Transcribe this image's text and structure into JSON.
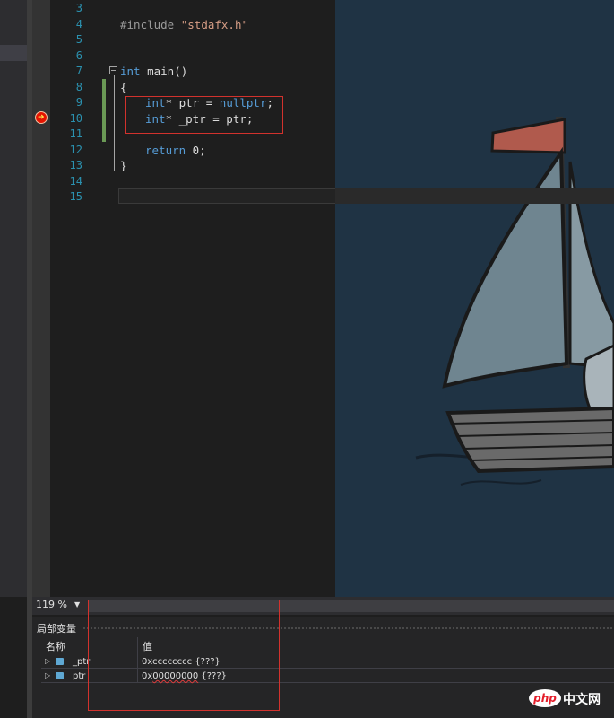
{
  "editor": {
    "line_numbers": [
      "3",
      "4",
      "5",
      "6",
      "7",
      "8",
      "9",
      "10",
      "11",
      "12",
      "13",
      "14",
      "15"
    ],
    "code": {
      "include_kw": "#include",
      "include_str": "\"stdafx.h\"",
      "main_kw": "int",
      "main_rest": " main()",
      "open_brace": "{",
      "l9_kw": "int",
      "l9_rest": "* ptr = ",
      "l9_null": "nullptr",
      "l9_end": ";",
      "l10_kw": "int",
      "l10_rest": "* _ptr = ptr;",
      "l12_kw": "return",
      "l12_rest": " 0;",
      "close_brace": "}"
    }
  },
  "breakpoint_icon": "arrow-right-icon",
  "status": {
    "zoom": "119 %"
  },
  "locals": {
    "title": "局部变量",
    "col_name": "名称",
    "col_value": "值",
    "rows": [
      {
        "name": "_ptr",
        "value": "0xcccccccc {???}"
      },
      {
        "name": "ptr",
        "value_prefix": "0x",
        "value_squig": "00000000",
        "value_suffix": " {???}"
      }
    ]
  },
  "watermark": {
    "logo": "php",
    "text": "中文网"
  }
}
